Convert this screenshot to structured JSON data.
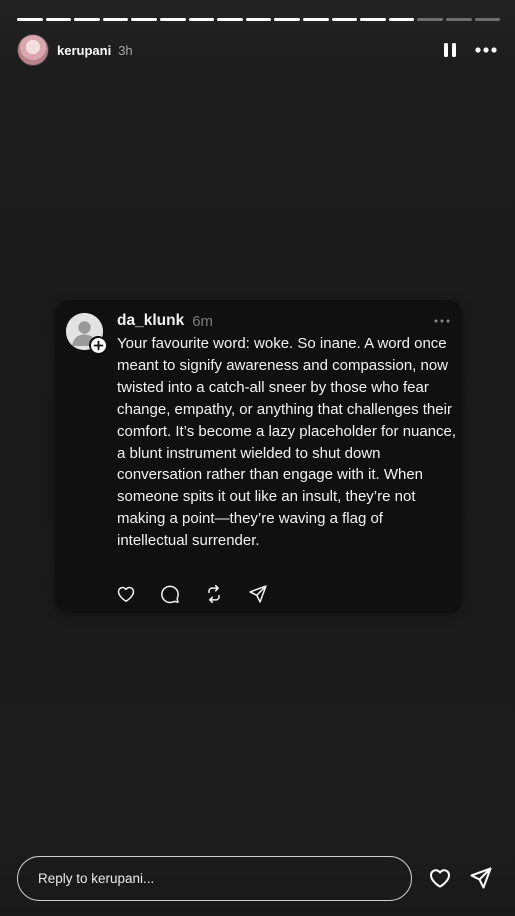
{
  "story": {
    "progress": {
      "total_segments": 17,
      "completed_segments": 14
    },
    "username": "kerupani",
    "time": "3h"
  },
  "post": {
    "username": "da_klunk",
    "time": "6m",
    "text": "Your favourite word: woke. So inane. A word once meant to signify awareness and compassion, now twisted into a catch-all sneer by those who fear change, empathy, or anything that challenges their comfort. It’s become a lazy placeholder for nuance, a blunt instrument wielded to shut down conversation rather than engage with it. When someone spits it out like an insult, they’re not making a point—they’re waving a flag of intellectual surrender."
  },
  "reply": {
    "placeholder": "Reply to kerupani..."
  },
  "icons": {
    "pause": "pause-icon",
    "more": "more-horizontal-icon",
    "like": "heart-icon",
    "comment": "comment-bubble-icon",
    "repost": "repost-icon",
    "share": "send-icon"
  },
  "colors": {
    "background": "#1a1a1a",
    "card": "#101010",
    "text": "#f3f3f3",
    "muted": "#7b7b7b"
  }
}
